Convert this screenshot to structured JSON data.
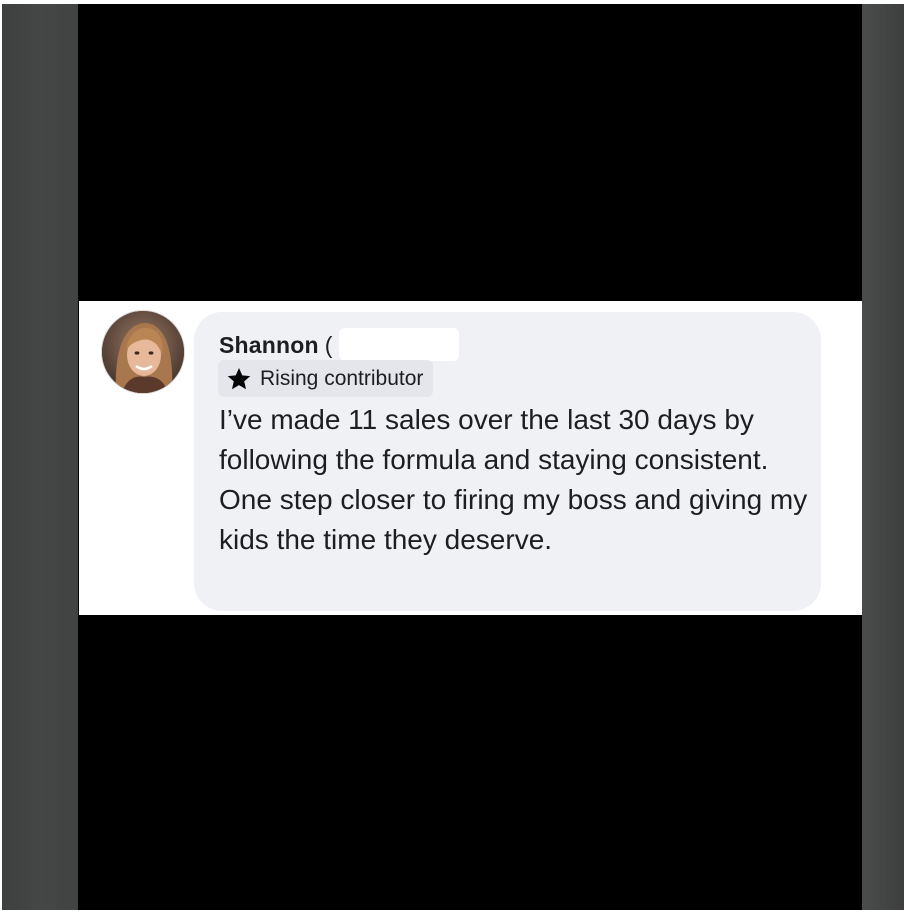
{
  "comment": {
    "author_name": "Shannon",
    "author_trail": "(",
    "badge": {
      "icon": "star-icon",
      "label": "Rising contributor"
    },
    "text": "I’ve made 11 sales over the last 30 days by following the formula and staying consistent.  One step closer to firing my boss and giving my kids the time they deserve."
  },
  "colors": {
    "bubble_background": "#f0f1f5",
    "badge_background": "#e4e6eb",
    "text": "#1c1e21"
  }
}
